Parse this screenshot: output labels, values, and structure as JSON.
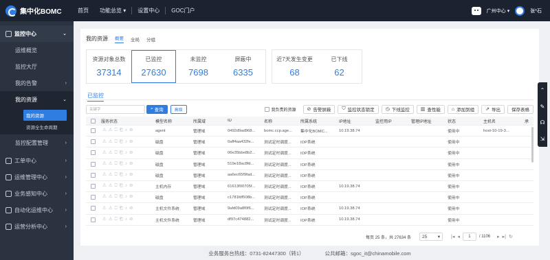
{
  "app": {
    "name": "集中化BOMC"
  },
  "topnav": [
    "首页",
    "功能总览",
    "设置中心",
    "GOC门户"
  ],
  "user": {
    "region": "广州中心",
    "name": "张*石"
  },
  "sidebar": {
    "sections": [
      {
        "label": "监控中心",
        "expanded": true
      },
      {
        "label": "工单中心"
      },
      {
        "label": "运维管理中心"
      },
      {
        "label": "业务感知中心"
      },
      {
        "label": "自动化运维中心"
      },
      {
        "label": "运营分析中心"
      }
    ],
    "monitor_items": [
      "运维概览",
      "监控大厅",
      "我的告警",
      "我的资源",
      "监控配置管理"
    ],
    "l3_items": [
      "我的资源",
      "资源全生命周期"
    ]
  },
  "page": {
    "title": "我的资源",
    "tabs": [
      "概要",
      "全局",
      "分组"
    ],
    "sub_tab": "已监控"
  },
  "stats": [
    {
      "label": "资源对象总数",
      "value": "37314"
    },
    {
      "label": "已监控",
      "value": "27630"
    },
    {
      "label": "未监控",
      "value": "7698"
    },
    {
      "label": "屏蔽中",
      "value": "6335"
    },
    {
      "label": "近7天发生变更",
      "value": "68"
    },
    {
      "label": "已下线",
      "value": "62"
    }
  ],
  "toolbar": {
    "search_placeholder": "关键字",
    "query": "查询",
    "advanced": "高级",
    "mine": "我负责的资源",
    "buttons": [
      "告警屏蔽",
      "监控状态锁定",
      "下线监控",
      "查性能",
      "添加到组",
      "导出",
      "保存表格"
    ]
  },
  "table": {
    "headers": [
      "服务状态",
      "模型名称",
      "所属域",
      "ID",
      "名称",
      "所属系统",
      "IP地址",
      "监控用IP",
      "管理IP地址",
      "状态",
      "主机名",
      "承"
    ],
    "rows": [
      [
        "agent",
        "管理域",
        "0492d9ad968...",
        "bomc.ccp.age...",
        "集中化BOMC...",
        "10.19.38.74",
        "",
        "",
        "使用中",
        "host-10-19-3..."
      ],
      [
        "磁盘",
        "管理域",
        "0aff4aa432fe...",
        "测试定时调度...",
        "IOP系统",
        "",
        "",
        "",
        "使用中",
        ""
      ],
      [
        "磁盘",
        "管理域",
        "06e35bbe8b2...",
        "测试定时调度...",
        "IOP系统",
        "",
        "",
        "",
        "使用中",
        ""
      ],
      [
        "磁盘",
        "管理域",
        "519e18ac8fd...",
        "测试定时调度...",
        "IOP系统",
        "",
        "",
        "",
        "使用中",
        ""
      ],
      [
        "磁盘",
        "管理域",
        "aa6ec65f9fad...",
        "测试定时调度...",
        "IOP系统",
        "",
        "",
        "",
        "使用中",
        ""
      ],
      [
        "主机内存",
        "管理域",
        "61613f00705f...",
        "测试定时调度...",
        "IOP系统",
        "10.19.38.74",
        "",
        "",
        "使用中",
        ""
      ],
      [
        "磁盘",
        "管理域",
        "c1781fdf508b...",
        "测试定时调度...",
        "IOP系统",
        "",
        "",
        "",
        "使用中",
        ""
      ],
      [
        "主机文件系统",
        "管理域",
        "9afd09a8f0f6...",
        "测试定时调度...",
        "IOP系统",
        "10.19.38.74",
        "",
        "",
        "使用中",
        ""
      ],
      [
        "主机文件系统",
        "管理域",
        "df97c474882...",
        "测试定时调度...",
        "IOP系统",
        "10.19.38.74",
        "",
        "",
        "使用中",
        ""
      ]
    ]
  },
  "pager": {
    "summary": "每页 25 条，共 27634 条",
    "size": "25",
    "page": "1",
    "total": "/ 1106"
  },
  "footer": {
    "hotline": "业务服务台热线：0731-82447300（转1）",
    "email": "公共邮箱：sgoc_it@chinamobile.com"
  },
  "colors": {
    "accent": "#2f7de1",
    "topbar": "#1c2330",
    "sidebar": "#2b3340"
  }
}
